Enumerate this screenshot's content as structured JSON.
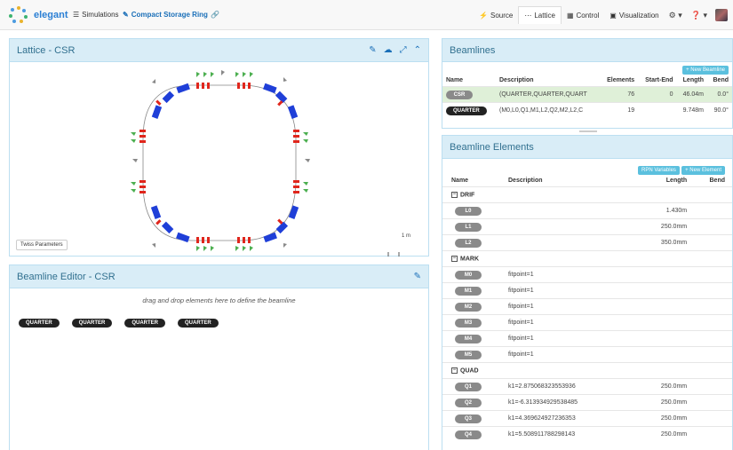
{
  "app": {
    "name": "elegant"
  },
  "nav": {
    "simulations": "Simulations",
    "simulation_name": "Compact Storage Ring",
    "tabs": [
      {
        "label": "Source",
        "icon": "bolt-icon"
      },
      {
        "label": "Lattice",
        "icon": "dots-icon"
      },
      {
        "label": "Control",
        "icon": "table-icon"
      },
      {
        "label": "Visualization",
        "icon": "picture-icon"
      }
    ]
  },
  "lattice_panel": {
    "title": "Lattice - CSR",
    "twiss_button": "Twiss Parameters",
    "scale_label": "1 m"
  },
  "editor_panel": {
    "title": "Beamline Editor - CSR",
    "hint": "drag and drop elements here to define the beamline",
    "items": [
      "QUARTER",
      "QUARTER",
      "QUARTER",
      "QUARTER"
    ]
  },
  "beamlines_panel": {
    "title": "Beamlines",
    "new_button": "+ New Beamline",
    "columns": [
      "Name",
      "Description",
      "Elements",
      "Start-End",
      "Length",
      "Bend"
    ],
    "rows": [
      {
        "name": "CSR",
        "description": "(QUARTER,QUARTER,QUART",
        "elements": "76",
        "start_end": "0",
        "length": "46.04m",
        "bend": "0.0°",
        "selected": true
      },
      {
        "name": "QUARTER",
        "description": "(M0,L0,Q1,M1,L2,Q2,M2,L2,C",
        "elements": "19",
        "start_end": "",
        "length": "9.748m",
        "bend": "90.0°",
        "selected": false
      }
    ]
  },
  "elements_panel": {
    "title": "Beamline Elements",
    "rpn_button": "RPN Variables",
    "new_button": "+ New Element",
    "columns": [
      "Name",
      "Description",
      "Length",
      "Bend"
    ],
    "groups": [
      {
        "type": "DRIF",
        "rows": [
          {
            "name": "L0",
            "description": "",
            "length": "1.430m"
          },
          {
            "name": "L1",
            "description": "",
            "length": "250.0mm"
          },
          {
            "name": "L2",
            "description": "",
            "length": "350.0mm"
          }
        ]
      },
      {
        "type": "MARK",
        "rows": [
          {
            "name": "M0",
            "description": "fitpoint=1",
            "length": ""
          },
          {
            "name": "M1",
            "description": "fitpoint=1",
            "length": ""
          },
          {
            "name": "M2",
            "description": "fitpoint=1",
            "length": ""
          },
          {
            "name": "M3",
            "description": "fitpoint=1",
            "length": ""
          },
          {
            "name": "M4",
            "description": "fitpoint=1",
            "length": ""
          },
          {
            "name": "M5",
            "description": "fitpoint=1",
            "length": ""
          }
        ]
      },
      {
        "type": "QUAD",
        "rows": [
          {
            "name": "Q1",
            "description": "k1=2.875068323553936",
            "length": "250.0mm"
          },
          {
            "name": "Q2",
            "description": "k1=-6.313934929538485",
            "length": "250.0mm"
          },
          {
            "name": "Q3",
            "description": "k1=4.369624927236353",
            "length": "250.0mm"
          },
          {
            "name": "Q4",
            "description": "k1=5.508911788298143",
            "length": "250.0mm"
          }
        ]
      }
    ]
  },
  "colors": {
    "dipole": "#1f3fd8",
    "quad": "#e0261c",
    "marker": "#4caf50",
    "header_bg": "#d9edf7",
    "selected_row": "#dff0d8"
  }
}
